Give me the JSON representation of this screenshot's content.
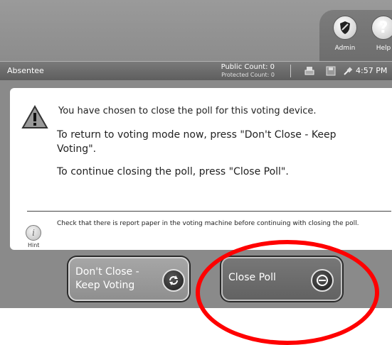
{
  "header": {
    "admin_label": "Admin",
    "help_label": "Help"
  },
  "status": {
    "mode": "Absentee",
    "public_count": "Public Count: 0",
    "protected_count": "Protected Count: 0",
    "time": "4:57 PM"
  },
  "dialog": {
    "line1": "You have chosen to close the poll for this voting device.",
    "line2": "To return to voting mode now, press \"Don't Close - Keep Voting\".",
    "line3": "To continue closing the poll, press \"Close Poll\".",
    "hint_label": "Hint",
    "hint_text": "Check that there is report paper in the voting machine before continuing with closing the poll."
  },
  "buttons": {
    "keep_voting_line1": "Don't Close -",
    "keep_voting_line2": "Keep Voting",
    "close_poll": "Close Poll"
  },
  "annotation": {
    "highlight_color": "#ff0000"
  },
  "icons": [
    "shield-icon",
    "help-icon",
    "warning-icon",
    "hint-icon",
    "refresh-icon",
    "minus-circle-icon"
  ]
}
